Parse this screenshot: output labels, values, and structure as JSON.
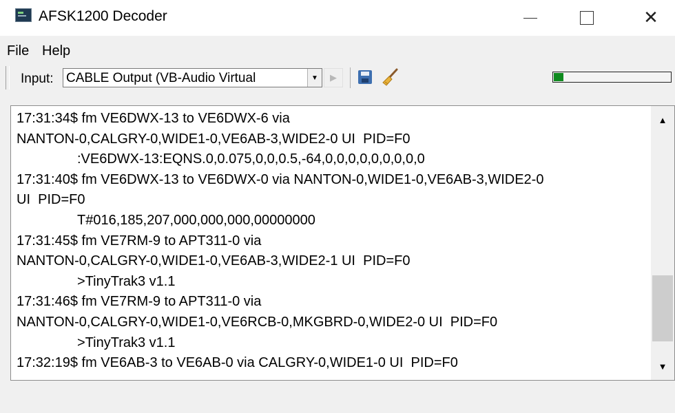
{
  "window": {
    "title": "AFSK1200 Decoder",
    "icon": "terminal-app-icon",
    "controls": {
      "minimize": "minimize-icon",
      "maximize": "maximize-icon",
      "close": "close-icon",
      "close_glyph": "✕"
    }
  },
  "menu": {
    "items": [
      {
        "label": "File"
      },
      {
        "label": "Help"
      }
    ]
  },
  "toolbar": {
    "input_label": "Input:",
    "input_value": "CABLE Output (VB-Audio Virtual",
    "combo_arrow": "▼",
    "play_glyph": "▶",
    "play_enabled": false,
    "save_icon": "save-icon",
    "clear_icon": "broom-icon",
    "level_fraction": 0.08,
    "level_color": "#0f8a1f"
  },
  "log": {
    "lines": [
      {
        "text": "17:31:34$ fm VE6DWX-13 to VE6DWX-6 via",
        "indent": false
      },
      {
        "text": "NANTON-0,CALGRY-0,WIDE1-0,VE6AB-3,WIDE2-0 UI  PID=F0",
        "indent": false
      },
      {
        "text": ":VE6DWX-13:EQNS.0,0.075,0,0,0.5,-64,0,0,0,0,0,0,0,0,0",
        "indent": true
      },
      {
        "text": "17:31:40$ fm VE6DWX-13 to VE6DWX-0 via NANTON-0,WIDE1-0,VE6AB-3,WIDE2-0",
        "indent": false
      },
      {
        "text": "UI  PID=F0",
        "indent": false
      },
      {
        "text": "T#016,185,207,000,000,000,00000000",
        "indent": true
      },
      {
        "text": "17:31:45$ fm VE7RM-9 to APT311-0 via",
        "indent": false
      },
      {
        "text": "NANTON-0,CALGRY-0,WIDE1-0,VE6AB-3,WIDE2-1 UI  PID=F0",
        "indent": false
      },
      {
        "text": ">TinyTrak3 v1.1",
        "indent": true
      },
      {
        "text": "17:31:46$ fm VE7RM-9 to APT311-0 via",
        "indent": false
      },
      {
        "text": "NANTON-0,CALGRY-0,WIDE1-0,VE6RCB-0,MKGBRD-0,WIDE2-0 UI  PID=F0",
        "indent": false
      },
      {
        "text": ">TinyTrak3 v1.1",
        "indent": true
      },
      {
        "text": "17:32:19$ fm VE6AB-3 to VE6AB-0 via CALGRY-0,WIDE1-0 UI  PID=F0",
        "indent": false
      }
    ],
    "scroll_up_glyph": "▲",
    "scroll_down_glyph": "▼"
  }
}
